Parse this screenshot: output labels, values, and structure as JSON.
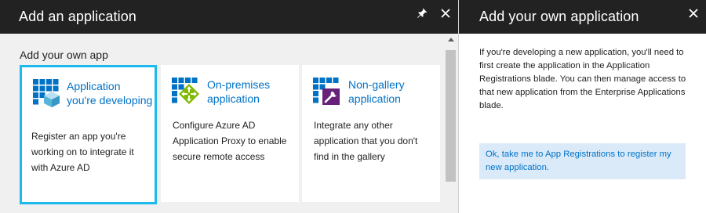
{
  "left_blade": {
    "title": "Add an application",
    "section_label": "Add your own app",
    "tiles": [
      {
        "title": "Application you're developing",
        "description": "Register an app you're working on to integrate it with Azure AD",
        "icon": "azure-app-cube-icon",
        "selected": true
      },
      {
        "title": "On-premises application",
        "description": "Configure Azure AD Application Proxy to enable secure remote access",
        "icon": "app-proxy-icon",
        "selected": false
      },
      {
        "title": "Non-gallery application",
        "description": "Integrate any other application that you don't find in the gallery",
        "icon": "non-gallery-app-icon",
        "selected": false
      }
    ]
  },
  "right_blade": {
    "title": "Add your own application",
    "info": "If you're developing a new application, you'll need to first create the application in the Application Registrations blade. You can then manage access to that new application from the Enterprise Applications blade.",
    "link": "Ok, take me to App Registrations to register my new application."
  },
  "colors": {
    "header_bg": "#222222",
    "accent_blue": "#0072c6",
    "selected_border": "#1dbbed",
    "link_box_bg": "#daeaf9"
  }
}
